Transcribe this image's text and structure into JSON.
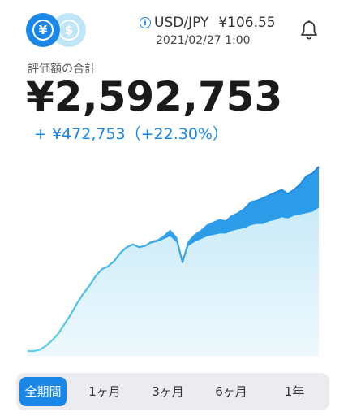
{
  "currency_toggle": {
    "yen_symbol": "¥",
    "usd_symbol": "$"
  },
  "rate": {
    "info_symbol": "i",
    "pair": "USD/JPY",
    "value": "¥106.55",
    "timestamp": "2021/02/27 1:00"
  },
  "total": {
    "label": "評価額の合計",
    "value": "¥2,592,753"
  },
  "gain": {
    "text": "+ ¥472,753（+22.30%）"
  },
  "range_tabs": [
    {
      "label": "全期間",
      "active": true
    },
    {
      "label": "1ヶ月",
      "active": false
    },
    {
      "label": "3ヶ月",
      "active": false
    },
    {
      "label": "6ヶ月",
      "active": false
    },
    {
      "label": "1年",
      "active": false
    }
  ],
  "colors": {
    "accent": "#1a86e6",
    "line_start": "#5fd3e8",
    "fill_light": "#d8f1fb"
  },
  "icons": {
    "bell": "bell-icon",
    "info": "info-icon"
  },
  "chart_data": {
    "type": "area",
    "series": [
      {
        "values": [
          0,
          0,
          1,
          4,
          8,
          13,
          20,
          27,
          35,
          42,
          48,
          55,
          60,
          62,
          66,
          72,
          76,
          78,
          76,
          77,
          80,
          81,
          84,
          88,
          83,
          65,
          80,
          85,
          88,
          92,
          94,
          96,
          95,
          99,
          101,
          104,
          109,
          110,
          112,
          114,
          116,
          118,
          115,
          118,
          122,
          128,
          130,
          135
        ]
      },
      {
        "values": [
          0,
          0,
          1,
          4,
          8,
          13,
          20,
          27,
          35,
          42,
          48,
          55,
          60,
          62,
          66,
          72,
          76,
          78,
          76,
          77,
          79,
          80,
          82,
          84,
          80,
          65,
          77,
          80,
          82,
          84,
          85,
          86,
          86,
          88,
          89,
          90,
          92,
          93,
          93,
          95,
          96,
          98,
          97,
          99,
          100,
          101,
          102,
          105
        ]
      }
    ]
  }
}
